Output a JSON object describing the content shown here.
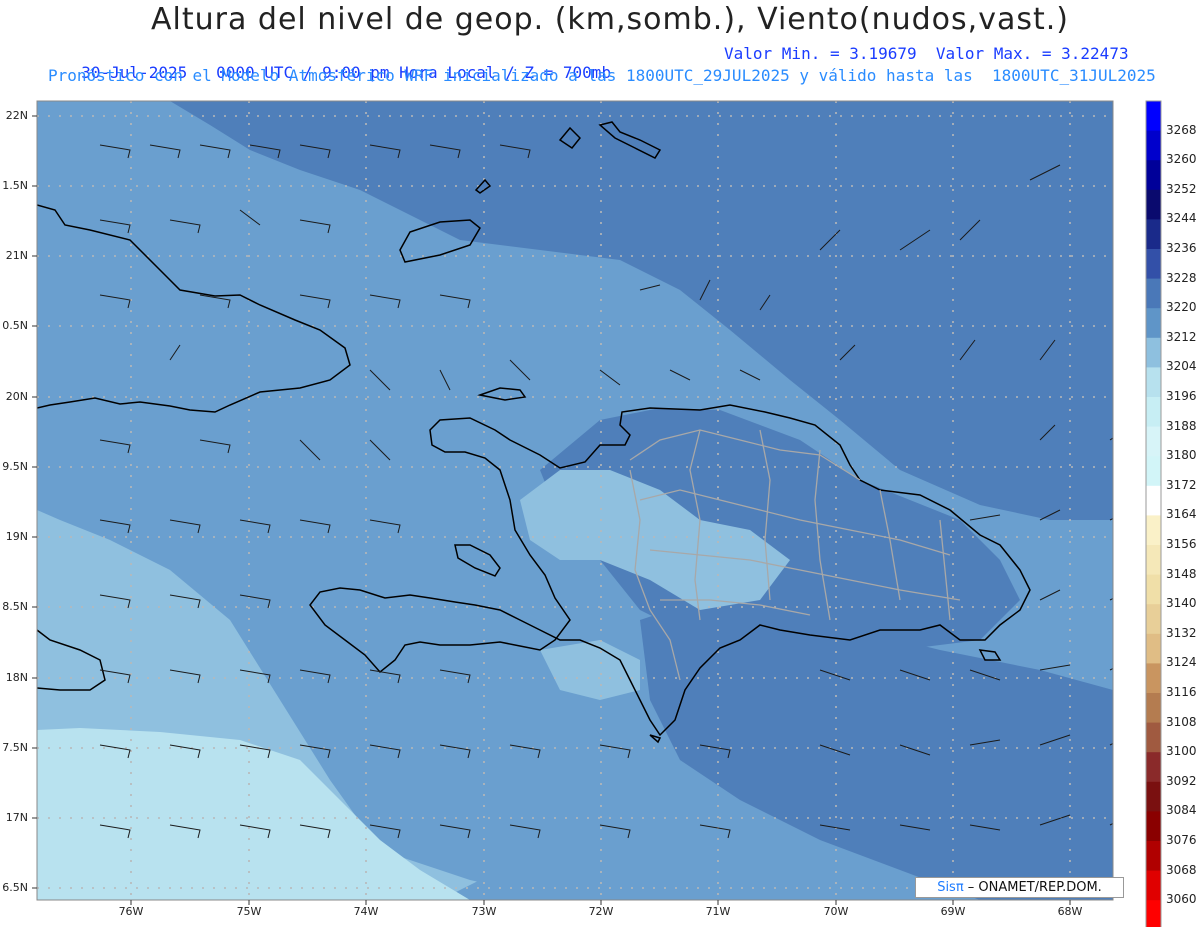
{
  "header": {
    "title": "Altura del nivel de geop. (km,somb.), Viento(nudos,vast.)",
    "line1_left": "30-Jul-2025   0000 UTC / 9:00 pm Hora Local / Z = 700mb",
    "line1_right": "Valor Min. = 3.19679  Valor Max. = 3.22473",
    "line2": "Pronóstico con el Modelo Atmosférico WRF inicializado a las 1800UTC_29JUL2025 y válido hasta las  1800UTC_31JUL2025"
  },
  "axes": {
    "lat_labels": [
      "22N",
      "1.5N",
      "21N",
      "0.5N",
      "20N",
      "9.5N",
      "19N",
      "8.5N",
      "18N",
      "7.5N",
      "17N",
      "6.5N"
    ],
    "lon_labels": [
      "76W",
      "75W",
      "74W",
      "73W",
      "72W",
      "71W",
      "70W",
      "69W",
      "68W"
    ]
  },
  "colorbar": {
    "labels": [
      "3268",
      "3260",
      "3252",
      "3244",
      "3236",
      "3228",
      "3220",
      "3212",
      "3204",
      "3196",
      "3188",
      "3180",
      "3172",
      "3164",
      "3156",
      "3148",
      "3140",
      "3132",
      "3124",
      "3116",
      "3108",
      "3100",
      "3092",
      "3084",
      "3076",
      "3068",
      "3060"
    ],
    "colors": [
      "#0000ff",
      "#0000cc",
      "#000099",
      "#0a0a6e",
      "#1a2a8a",
      "#3350a8",
      "#4a78b8",
      "#5f95c8",
      "#8ec0df",
      "#b7e1ee",
      "#c7eef4",
      "#d7f4f8",
      "#d2f5f8",
      "#ffffff",
      "#faf1c8",
      "#f5e8b8",
      "#f0dfa8",
      "#e8cf98",
      "#e0bd85",
      "#c99560",
      "#b47c50",
      "#a05a40",
      "#8a2a2a",
      "#7a1010",
      "#8a0000",
      "#b00000",
      "#e00000",
      "#ff0000"
    ]
  },
  "legend_colors": {
    "deep": "#4f7fba",
    "mid": "#6a9fcf",
    "light": "#8fc0df",
    "lightest": "#b8e2ef"
  },
  "credit": {
    "brand": "Sisπ",
    "text": " – ONAMET/REP.DOM."
  }
}
